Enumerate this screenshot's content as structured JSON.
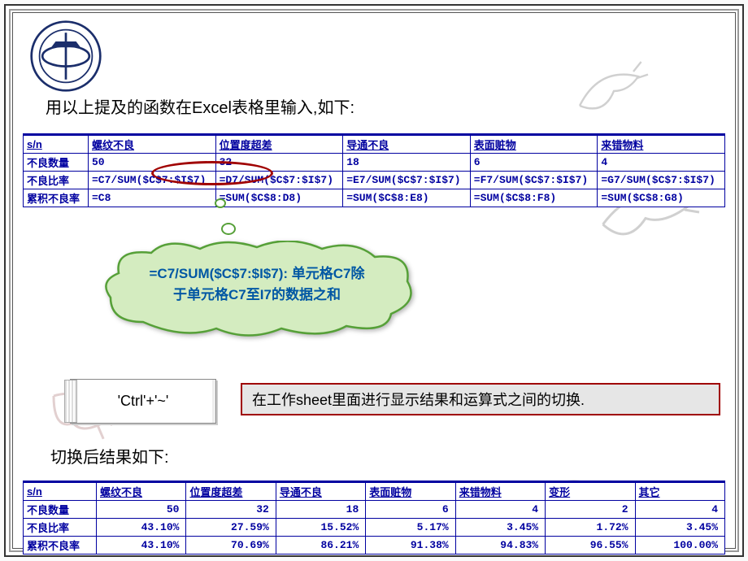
{
  "heading": "用以上提及的函数在Excel表格里输入,如下:",
  "table1": {
    "header_sn": "s/n",
    "headers": [
      "螺纹不良",
      "位置度超差",
      "导通不良",
      "表面赃物",
      "来错物料"
    ],
    "rows": [
      {
        "label": "不良数量",
        "cells": [
          "50",
          "32",
          "18",
          "6",
          "4"
        ]
      },
      {
        "label": "不良比率",
        "cells": [
          "=C7/SUM($C$7:$I$7)",
          "=D7/SUM($C$7:$I$7)",
          "=E7/SUM($C$7:$I$7)",
          "=F7/SUM($C$7:$I$7)",
          "=G7/SUM($C$7:$I$7)"
        ]
      },
      {
        "label": "累积不良率",
        "cells": [
          "=C8",
          "=SUM($C$8:D8)",
          "=SUM($C$8:E8)",
          "=SUM($C$8:F8)",
          "=SUM($C$8:G8)"
        ]
      }
    ]
  },
  "callout": {
    "formula": "=C7/SUM($C$7:$I$7):",
    "desc1": " 单元格C7除",
    "desc2": "于单元格C7至I7的数据之和"
  },
  "shortcut": "'Ctrl'+'~'",
  "shortcut_desc": "在工作sheet里面进行显示结果和运算式之间的切换.",
  "result_title": "切换后结果如下:",
  "table2": {
    "header_sn": "s/n",
    "headers": [
      "螺纹不良",
      "位置度超差",
      "导通不良",
      "表面赃物",
      "来错物料",
      "变形",
      "其它"
    ],
    "rows": [
      {
        "label": "不良数量",
        "cells": [
          "50",
          "32",
          "18",
          "6",
          "4",
          "2",
          "4"
        ]
      },
      {
        "label": "不良比率",
        "cells": [
          "43.10%",
          "27.59%",
          "15.52%",
          "5.17%",
          "3.45%",
          "1.72%",
          "3.45%"
        ]
      },
      {
        "label": "累积不良率",
        "cells": [
          "43.10%",
          "70.69%",
          "86.21%",
          "91.38%",
          "94.83%",
          "96.55%",
          "100.00%"
        ]
      }
    ]
  }
}
